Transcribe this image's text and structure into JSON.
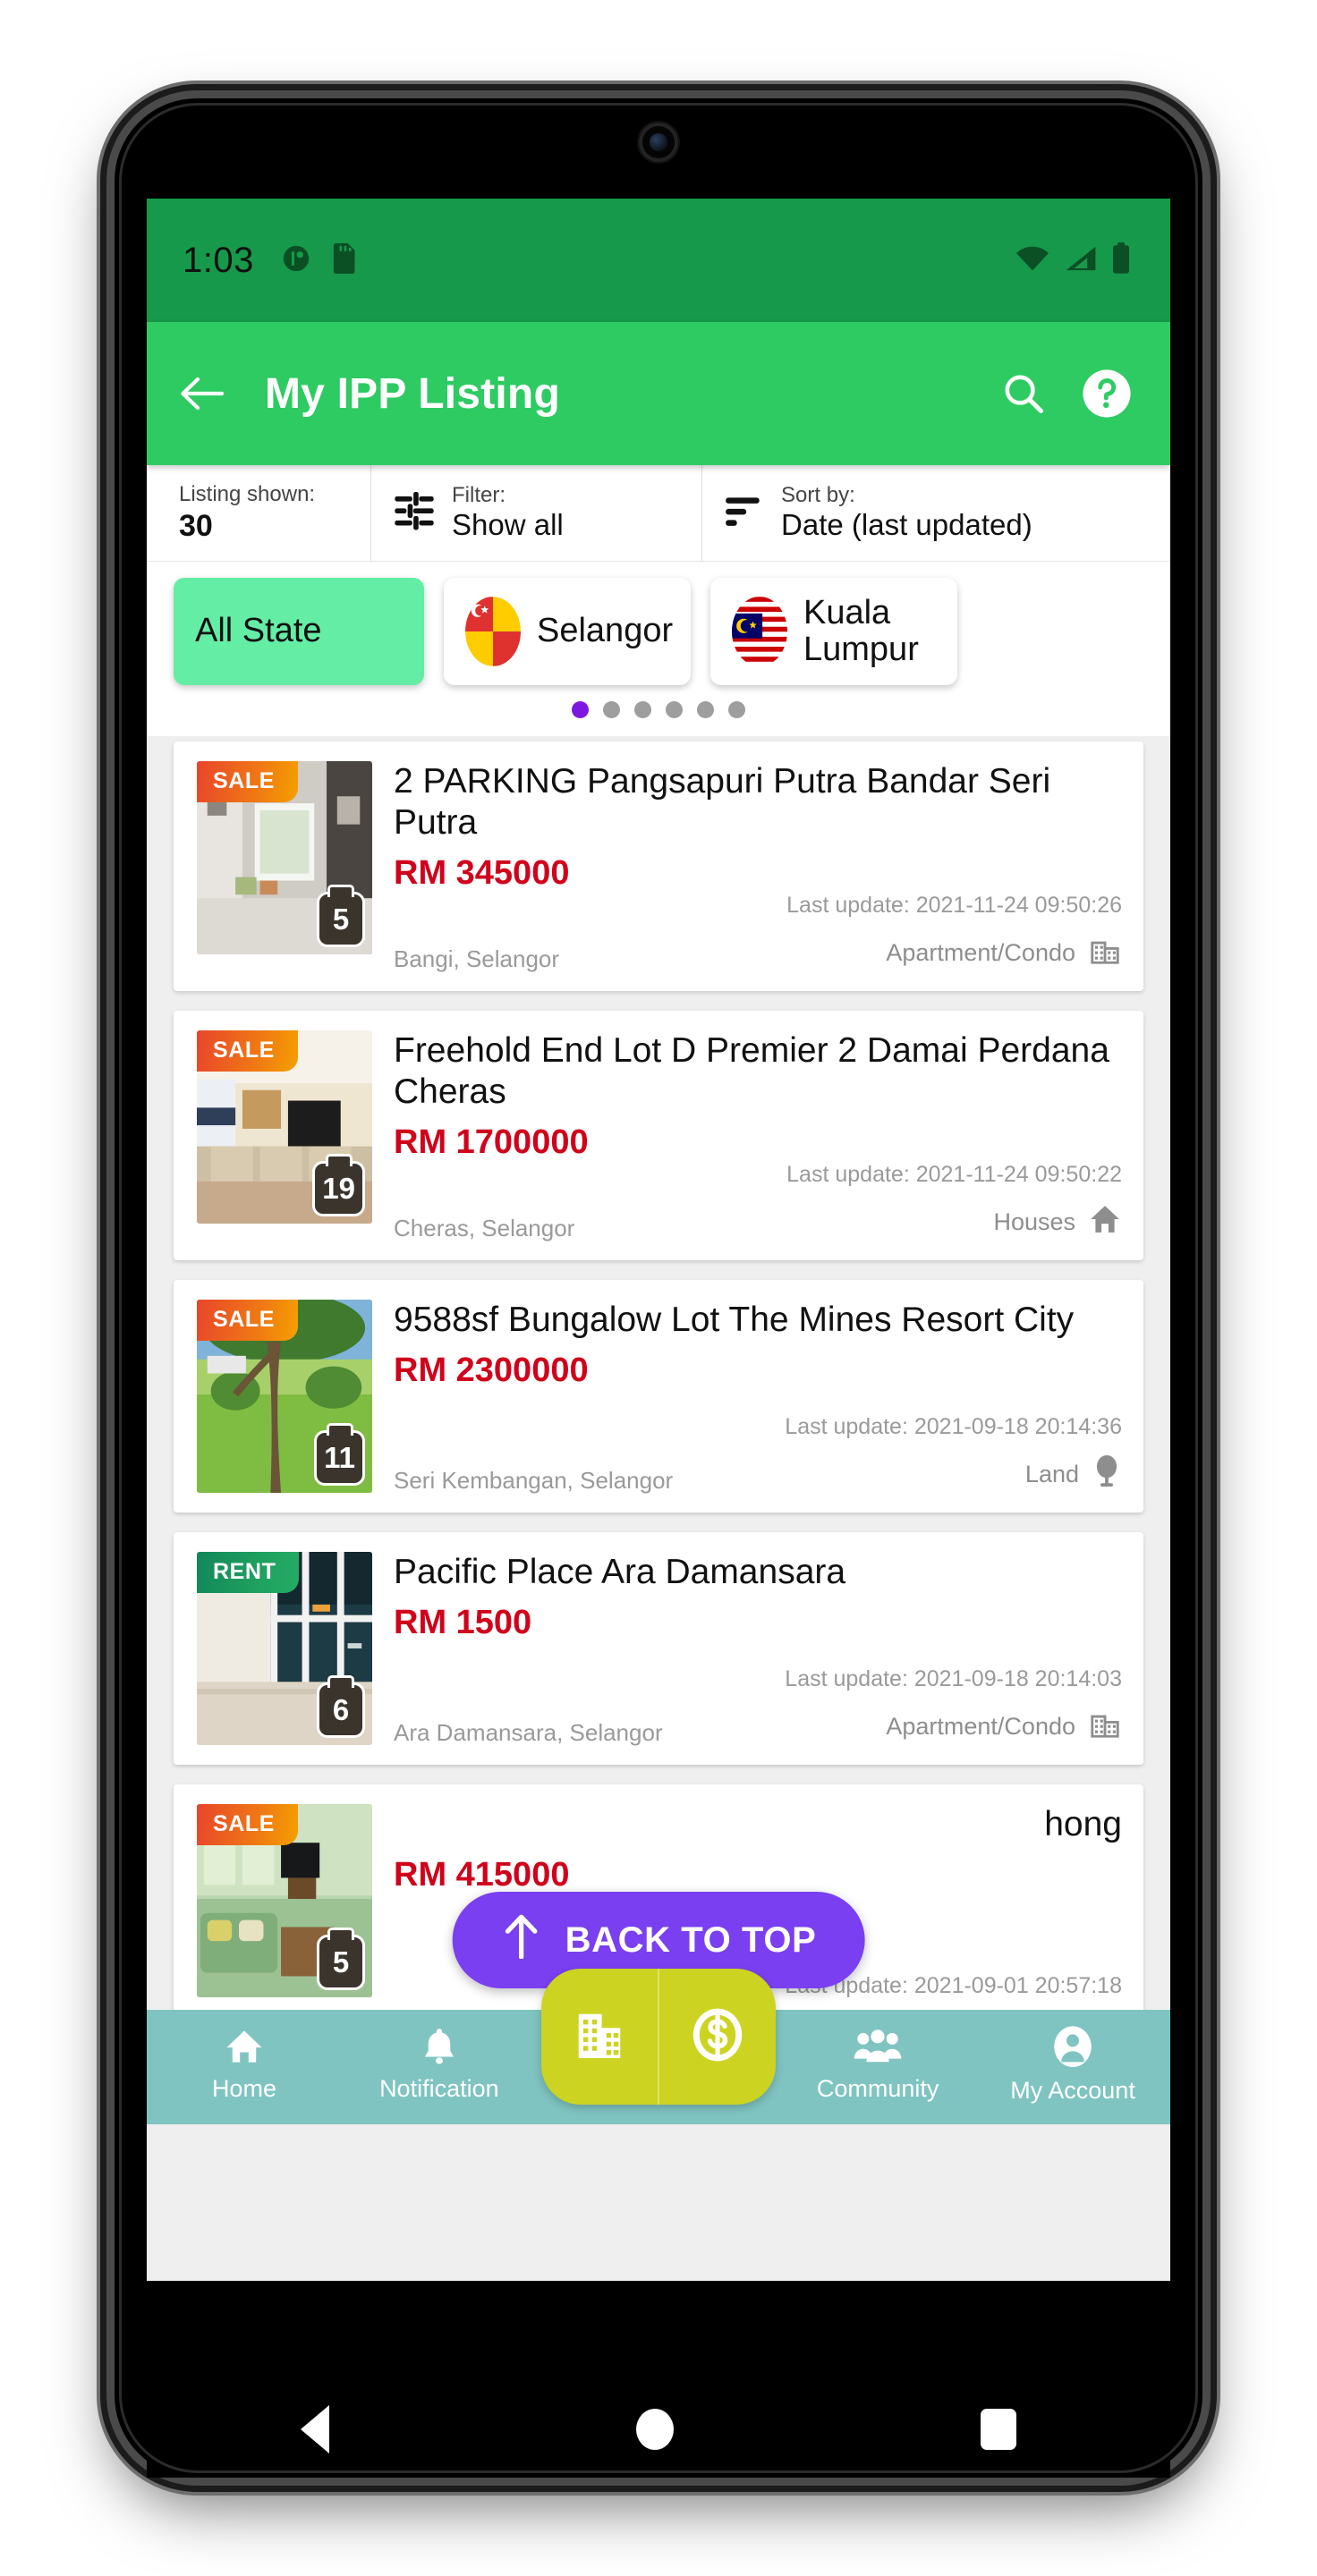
{
  "status_bar": {
    "time": "1:03",
    "left_icons": [
      "do-not-disturb-icon",
      "sd-card-icon"
    ],
    "right_icons": [
      "wifi-icon",
      "cellular-signal-icon",
      "battery-icon"
    ]
  },
  "app_bar": {
    "back_icon": "back-arrow-icon",
    "title": "My IPP Listing",
    "search_icon": "search-icon",
    "help_icon": "help-circle-icon",
    "background_color": "#2ecb63"
  },
  "filter_bar": {
    "listing_shown_label": "Listing shown:",
    "listing_shown_value": "30",
    "filter_label": "Filter:",
    "filter_value": "Show all",
    "sort_label": "Sort by:",
    "sort_value": "Date (last updated)"
  },
  "state_chips": {
    "items": [
      {
        "label": "All State",
        "selected": true,
        "flag": ""
      },
      {
        "label": "Selangor",
        "selected": false,
        "flag": "selangor-flag-icon"
      },
      {
        "label": "Kuala Lumpur",
        "selected": false,
        "flag": "kuala-lumpur-flag-icon"
      }
    ],
    "dots_total": 6,
    "active_dot": 1,
    "active_dot_color": "#7d16e0",
    "selected_color": "#64eda5"
  },
  "listings": [
    {
      "badge": "SALE",
      "badge_type": "sale",
      "photo_count": "5",
      "title": "2 PARKING Pangsapuri Putra Bandar Seri Putra",
      "price": "RM 345000",
      "last_update": "Last update: 2021-11-24 09:50:26",
      "location": "Bangi, Selangor",
      "property_type": "Apartment/Condo",
      "type_icon": "apartment-icon"
    },
    {
      "badge": "SALE",
      "badge_type": "sale",
      "photo_count": "19",
      "title": "Freehold End Lot D Premier 2 Damai Perdana Cheras",
      "price": "RM 1700000",
      "last_update": "Last update: 2021-11-24 09:50:22",
      "location": "Cheras, Selangor",
      "property_type": "Houses",
      "type_icon": "house-icon"
    },
    {
      "badge": "SALE",
      "badge_type": "sale",
      "photo_count": "11",
      "title": "9588sf Bungalow Lot The Mines Resort City",
      "price": "RM 2300000",
      "last_update": "Last update: 2021-09-18 20:14:36",
      "location": "Seri Kembangan, Selangor",
      "property_type": "Land",
      "type_icon": "tree-icon"
    },
    {
      "badge": "RENT",
      "badge_type": "rent",
      "photo_count": "6",
      "title": "Pacific Place Ara Damansara",
      "price": "RM 1500",
      "last_update": "Last update: 2021-09-18 20:14:03",
      "location": "Ara Damansara, Selangor",
      "property_type": "Apartment/Condo",
      "type_icon": "apartment-icon"
    },
    {
      "badge": "SALE",
      "badge_type": "sale",
      "photo_count": "5",
      "title": "hong",
      "price": "RM 415000",
      "last_update": "Last update: 2021-09-01 20:57:18",
      "location": "",
      "property_type": "",
      "type_icon": ""
    }
  ],
  "back_to_top": {
    "label": "BACK TO TOP",
    "icon": "arrow-up-icon",
    "color": "#7a3ff0"
  },
  "bottom_nav": {
    "background_color": "#7fc4c1",
    "fab_color": "#ccd421",
    "items": [
      {
        "label": "Home",
        "icon": "home-icon"
      },
      {
        "label": "Notification",
        "icon": "bell-icon"
      },
      {
        "label": "Community",
        "icon": "people-icon"
      },
      {
        "label": "My Account",
        "icon": "account-circle-icon"
      }
    ],
    "fab_buttons": [
      {
        "icon": "building-icon"
      },
      {
        "icon": "dollar-circle-icon"
      }
    ]
  },
  "android_nav": {
    "back": "android-back-icon",
    "home": "android-home-icon",
    "recents": "android-recents-icon"
  }
}
